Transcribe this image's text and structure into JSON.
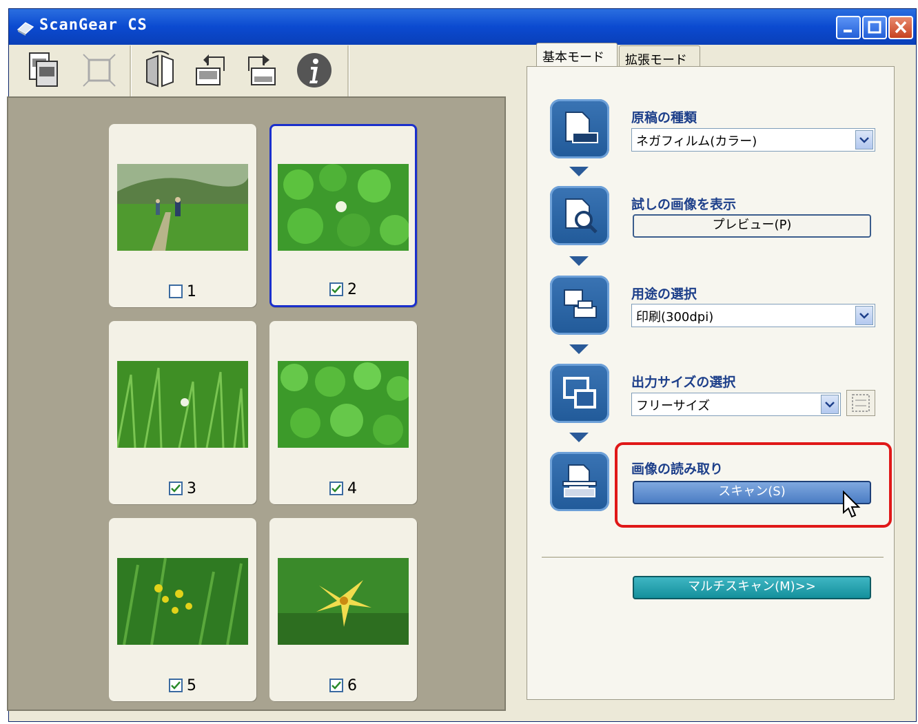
{
  "window": {
    "title": "ScanGear CS"
  },
  "colors": {
    "titlebar": "#0b4ad0",
    "step_icon": "#2a5f9e",
    "highlight": "#e01818",
    "selected_border": "#1a2fcc",
    "multi_scan": "#1a9aa6"
  },
  "toolbar": {
    "icons": [
      "film-strip-icon",
      "crop-frame-icon",
      "flip-horizontal-icon",
      "rotate-left-icon",
      "rotate-right-icon",
      "info-icon"
    ]
  },
  "thumbnails": [
    {
      "number": "1",
      "checked": false,
      "selected": false
    },
    {
      "number": "2",
      "checked": true,
      "selected": true
    },
    {
      "number": "3",
      "checked": true,
      "selected": false
    },
    {
      "number": "4",
      "checked": true,
      "selected": false
    },
    {
      "number": "5",
      "checked": true,
      "selected": false
    },
    {
      "number": "6",
      "checked": true,
      "selected": false
    }
  ],
  "tabs": [
    {
      "label": "基本モード",
      "active": true
    },
    {
      "label": "拡張モード",
      "active": false
    }
  ],
  "steps": {
    "source": {
      "label": "原稿の種類",
      "value": "ネガフィルム(カラー)"
    },
    "preview": {
      "label": "試しの画像を表示",
      "button": "プレビュー(P)"
    },
    "purpose": {
      "label": "用途の選択",
      "value": "印刷(300dpi)"
    },
    "output": {
      "label": "出力サイズの選択",
      "value": "フリーサイズ"
    },
    "scan": {
      "label": "画像の読み取り",
      "button": "スキャン(S)"
    }
  },
  "multi_scan": {
    "button": "マルチスキャン(M)>>"
  }
}
